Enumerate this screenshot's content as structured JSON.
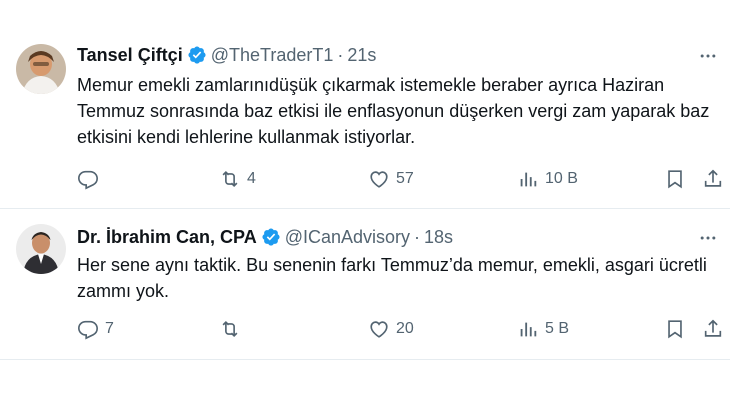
{
  "tweets": [
    {
      "name": "Tansel Çiftçi",
      "handle": "@TheTraderT1",
      "separator": "·",
      "time": "21s",
      "text": "Memur emekli zamlarınıdüşük çıkarmak istemekle beraber ayrıca Haziran Temmuz sonrasında baz etkisi ile enflasyonun düşerken vergi zam yaparak baz etkisini kendi lehlerine kullanmak istiyorlar.",
      "replies": "",
      "retweets": "4",
      "likes": "57",
      "views": "10 B",
      "icons": {
        "reply": "reply-icon",
        "retweet": "retweet-icon",
        "like": "heart-icon",
        "views": "views-icon",
        "bookmark": "bookmark-icon",
        "share": "share-icon",
        "verified": "verified-badge-icon",
        "more": "more-icon"
      }
    },
    {
      "name": "Dr. İbrahim Can, CPA",
      "handle": "@ICanAdvisory",
      "separator": "·",
      "time": "18s",
      "text": "Her sene aynı taktik. Bu senenin farkı Temmuz’da memur, emekli, asgari ücretli zammı yok.",
      "replies": "7",
      "retweets": "",
      "likes": "20",
      "views": "5 B",
      "icons": {
        "reply": "reply-icon",
        "retweet": "retweet-icon",
        "like": "heart-icon",
        "views": "views-icon",
        "bookmark": "bookmark-icon",
        "share": "share-icon",
        "verified": "verified-badge-icon",
        "more": "more-icon"
      }
    }
  ],
  "colors": {
    "text": "#0f1419",
    "secondary": "#536471",
    "verified": "#1d9bf0",
    "divider": "#e6ecf0"
  }
}
